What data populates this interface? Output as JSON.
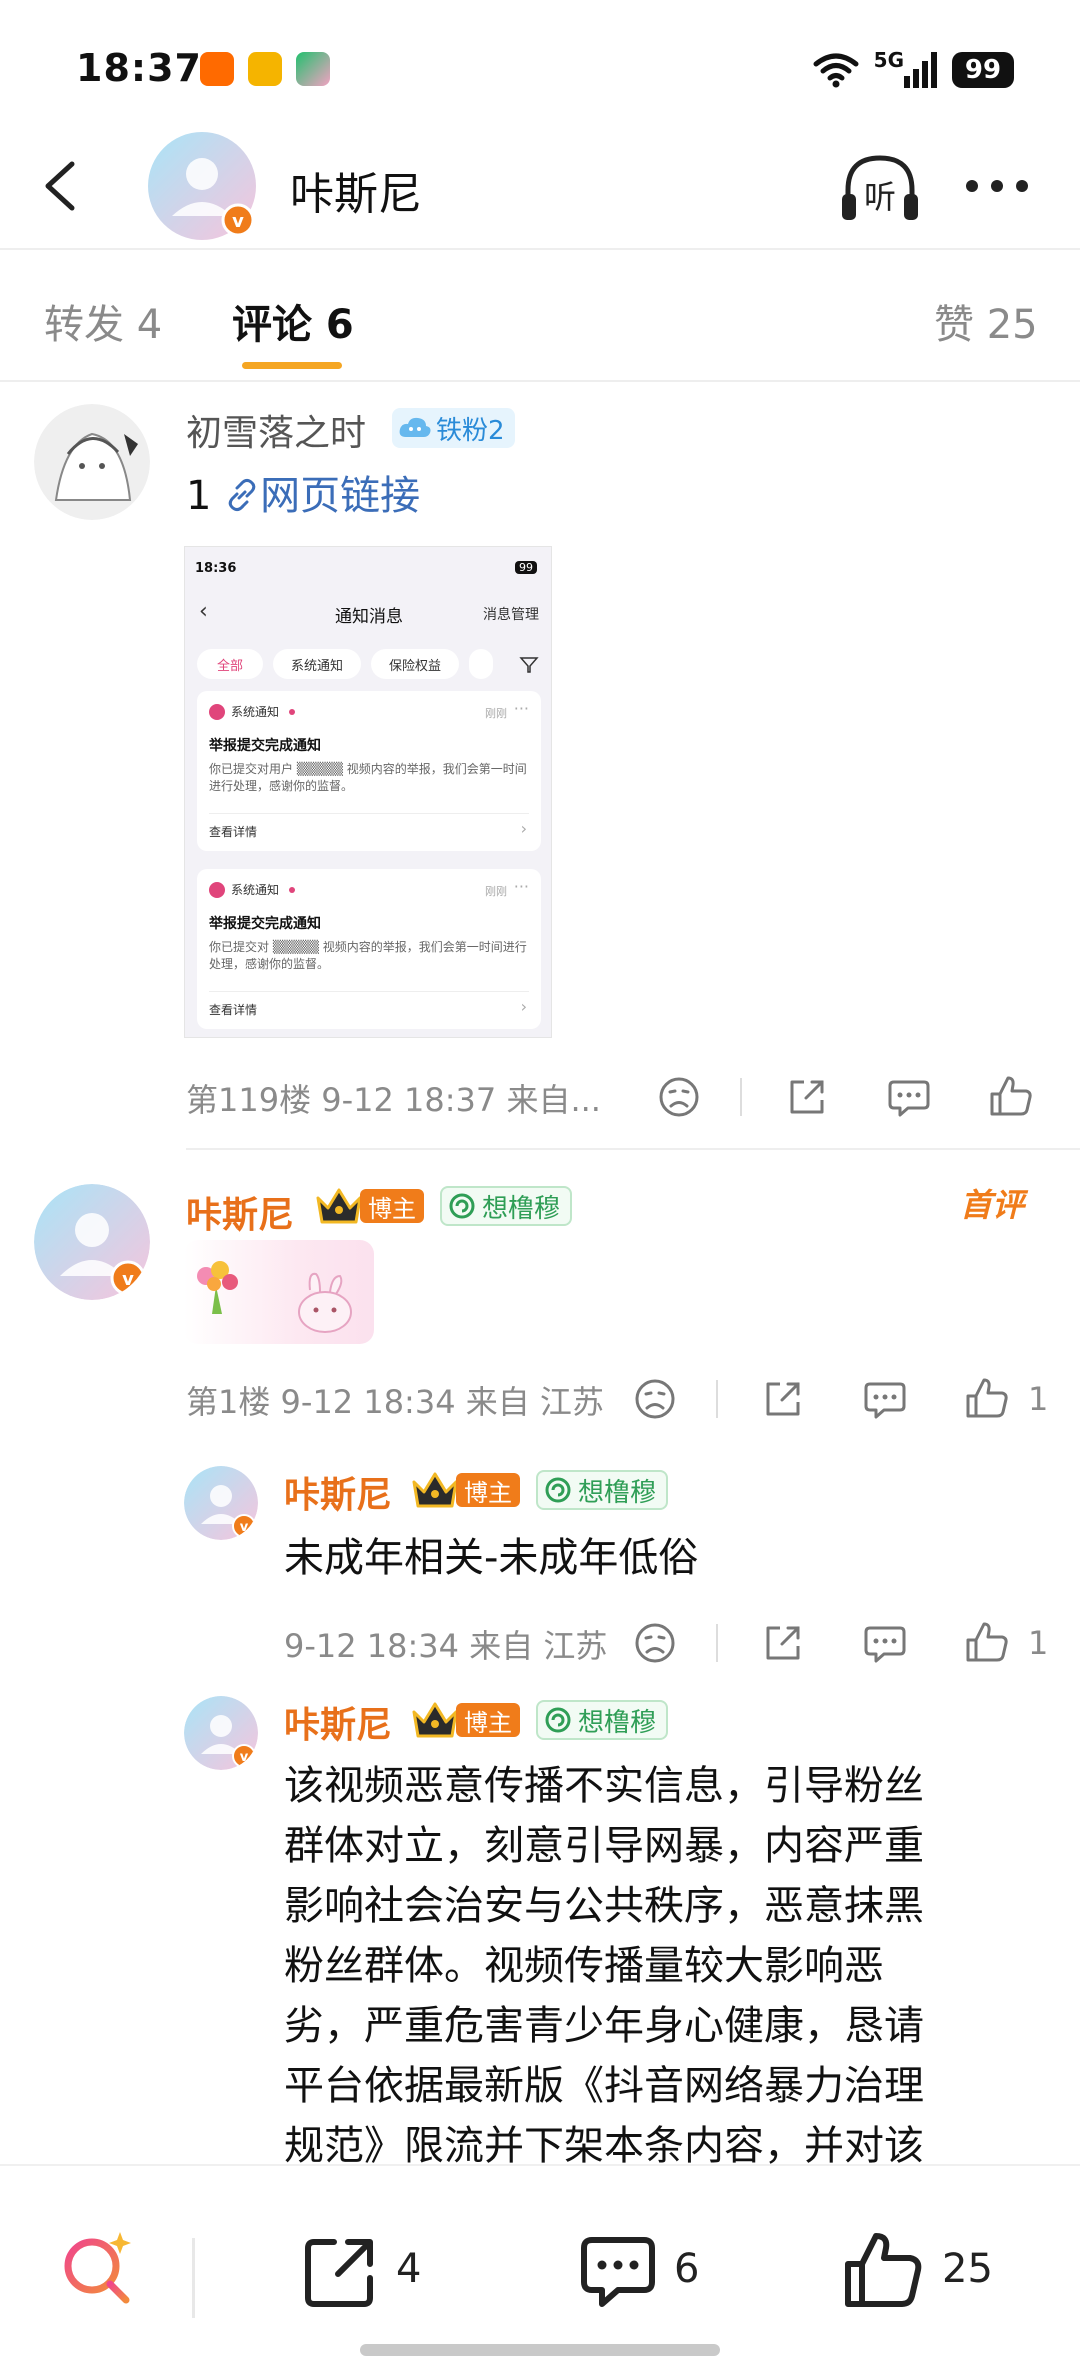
{
  "status_bar": {
    "time": "18:37",
    "network": "5G",
    "battery": "99",
    "app_icon_colors": [
      "#ff6a00",
      "#f5b400",
      "#22c06e"
    ]
  },
  "header": {
    "name": "咔斯尼",
    "listen_label": "听"
  },
  "tabs": [
    {
      "label": "转发 4",
      "active": false
    },
    {
      "label": "评论 6",
      "active": true
    },
    {
      "label": "赞 25",
      "active": false
    }
  ],
  "comment1": {
    "username": "初雪落之时",
    "fan_badge": "铁粉2",
    "text_prefix": "1 ",
    "link_text": "网页链接",
    "meta": "第119楼 9-12 18:37 来自..."
  },
  "screenshot": {
    "status_time": "18:36",
    "battery": "99",
    "title": "通知消息",
    "manage": "消息管理",
    "chips": [
      "全部",
      "系统通知",
      "保险权益"
    ],
    "cards": [
      {
        "head": "系统通知",
        "tag": "刚刚",
        "title": "举报提交完成通知",
        "body": "你已提交对用户 ▒▒▒▒▒ 视频内容的举报，我们会第一时间进行处理，感谢你的监督。",
        "detail": "查看详情"
      },
      {
        "head": "系统通知",
        "tag": "刚刚",
        "title": "举报提交完成通知",
        "body": "你已提交对 ▒▒▒▒▒ 视频内容的举报，我们会第一时间进行处理，感谢你的监督。",
        "detail": "查看详情"
      }
    ]
  },
  "comment2": {
    "username": "咔斯尼",
    "host_tag": "博主",
    "mood": "想橹穆",
    "first_review": "首评",
    "meta": "第1楼 9-12 18:34 来自 江苏",
    "likes": "1"
  },
  "reply1": {
    "username": "咔斯尼",
    "host_tag": "博主",
    "mood": "想橹穆",
    "text": "未成年相关-未成年低俗",
    "meta": "9-12 18:34 来自 江苏",
    "likes": "1"
  },
  "reply2": {
    "username": "咔斯尼",
    "host_tag": "博主",
    "mood": "想橹穆",
    "lines": [
      "该视频恶意传播不实信息，引导粉丝",
      "群体对立，刻意引导网暴，内容严重",
      "影响社会治安与公共秩序，恶意抹黑",
      "粉丝群体。视频传播量较大影响恶",
      "劣，严重危害青少年身心健康，恳请",
      "平台依据最新版《抖音网络暴力治理",
      "规范》限流并下架本条内容，并对该"
    ]
  },
  "bottom_bar": {
    "forward_count": "4",
    "comment_count": "6",
    "like_count": "25"
  },
  "colors": {
    "accent": "#f5a623",
    "username_orange": "#e8701a",
    "link": "#3b6db8",
    "host_tag": "#f07c1a"
  }
}
